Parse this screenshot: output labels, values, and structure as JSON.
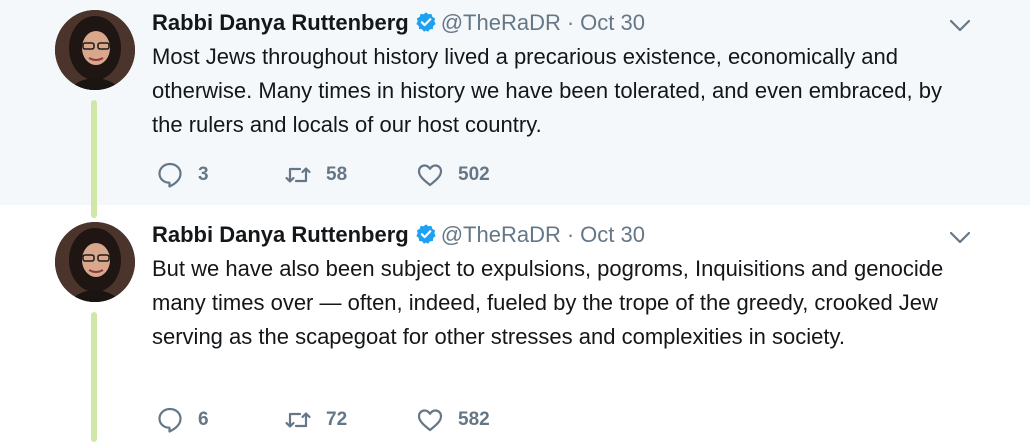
{
  "tweets": [
    {
      "author_name": "Rabbi Danya Ruttenberg",
      "handle": "@TheRaDR",
      "separator": "·",
      "date": "Oct 30",
      "text": "Most Jews throughout history lived a precarious existence, economically and otherwise. Many times in history we have been tolerated, and even embraced, by the rulers and locals of our host country.",
      "replies": "3",
      "retweets": "58",
      "likes": "502"
    },
    {
      "author_name": "Rabbi Danya Ruttenberg",
      "handle": "@TheRaDR",
      "separator": "·",
      "date": "Oct 30",
      "text": "But we have also been subject to expulsions, pogroms, Inquisitions and genocide many times over — often, indeed, fueled by the trope of the greedy, crooked Jew serving as the scapegoat for other stresses and complexities in society.",
      "replies": "6",
      "retweets": "72",
      "likes": "582"
    }
  ],
  "colors": {
    "thread_line": "#cfe8a8",
    "verified_badge": "#1da1f2",
    "secondary_text": "#657786",
    "highlight_background": "#f5f8fa"
  },
  "icons": {
    "reply": "reply-icon",
    "retweet": "retweet-icon",
    "like": "heart-icon",
    "menu": "chevron-down-icon",
    "verified": "verified-badge-icon"
  }
}
